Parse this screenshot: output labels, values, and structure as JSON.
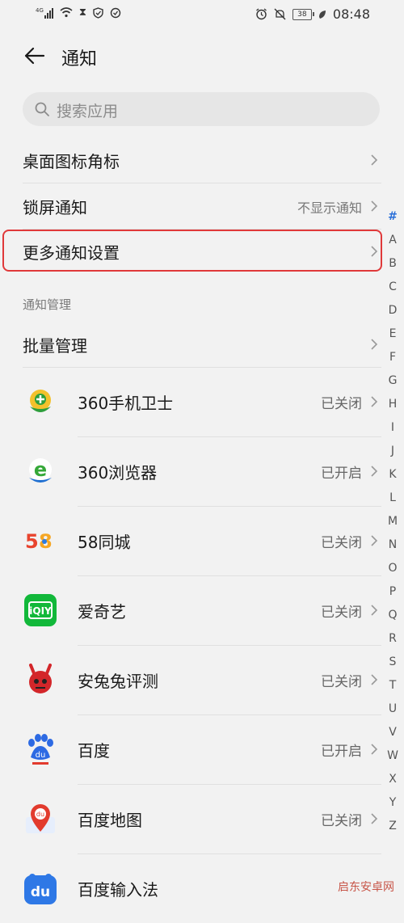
{
  "status_bar": {
    "network": "4G",
    "time": "08:48",
    "battery": "38",
    "icons": [
      "signal-icon",
      "wifi-icon",
      "hourglass-icon",
      "shield-icon",
      "vpn-icon",
      "alarm-icon",
      "mute-icon",
      "battery-icon",
      "leaf-icon"
    ]
  },
  "header": {
    "title": "通知"
  },
  "search": {
    "placeholder": "搜索应用"
  },
  "settings": {
    "badge_label": "桌面图标角标",
    "lockscreen_label": "锁屏通知",
    "lockscreen_value": "不显示通知",
    "more_label": "更多通知设置"
  },
  "section": {
    "title": "通知管理"
  },
  "batch": {
    "label": "批量管理"
  },
  "apps": [
    {
      "name": "360手机卫士",
      "status": "已关闭",
      "icon": "360-security-icon"
    },
    {
      "name": "360浏览器",
      "status": "已开启",
      "icon": "360-browser-icon"
    },
    {
      "name": "58同城",
      "status": "已关闭",
      "icon": "58-icon"
    },
    {
      "name": "爱奇艺",
      "status": "已关闭",
      "icon": "iqiyi-icon"
    },
    {
      "name": "安兔兔评测",
      "status": "已关闭",
      "icon": "antutu-icon"
    },
    {
      "name": "百度",
      "status": "已开启",
      "icon": "baidu-icon"
    },
    {
      "name": "百度地图",
      "status": "已关闭",
      "icon": "baidu-map-icon"
    },
    {
      "name": "百度输入法",
      "status": "",
      "icon": "baidu-input-icon"
    }
  ],
  "alphabet": [
    "#",
    "A",
    "B",
    "C",
    "D",
    "E",
    "F",
    "G",
    "H",
    "I",
    "J",
    "K",
    "L",
    "M",
    "N",
    "O",
    "P",
    "Q",
    "R",
    "S",
    "T",
    "U",
    "V",
    "W",
    "X",
    "Y",
    "Z"
  ],
  "watermark": "启东安卓网"
}
